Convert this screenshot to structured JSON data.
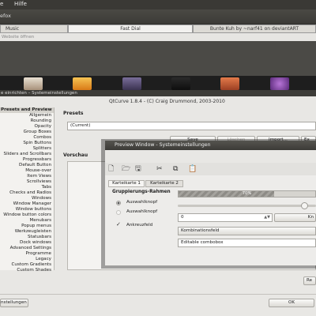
{
  "firefox": {
    "menu_left": "e",
    "menu_help": "Hilfe",
    "title": "efox",
    "tabs": [
      "Music",
      "Fast Dial",
      "Bunte Kuh by ~narf41 on deviantART"
    ],
    "url_placeholder": "Website öffnen"
  },
  "qtcurve": {
    "window_title": "e einrichten – Systemeinstellungen",
    "version": "QtCurve 1.8.4 - (C) Craig Drummond, 2003-2010",
    "categories": [
      "Presets and Preview",
      "Allgemein",
      "Rounding",
      "Opacity",
      "Group Boxes",
      "Combos",
      "Spin Buttons",
      "Splitters",
      "Sliders and Scrollbars",
      "Progressbars",
      "Default Button",
      "Mouse-over",
      "Item Views",
      "Scrollviews",
      "Tabs",
      "Checks and Radios",
      "Windows",
      "Window Manager",
      "Window buttons",
      "Window button colors",
      "Menubars",
      "Popup menus",
      "Werkzeugleisten",
      "Statusbars",
      "Dock windows",
      "Advanced Settings",
      "Programme",
      "Legacy",
      "Custom Gradients",
      "Custom Shades"
    ],
    "presets_label": "Presets",
    "preset_value": "(Current)",
    "buttons": {
      "save": "Save",
      "delete": "Löschen",
      "import": "Import...",
      "export": "Ex"
    },
    "preview_label": "Vorschau",
    "bottom": {
      "left_button": "nstellungen",
      "ok": "OK",
      "right_button": "Re"
    }
  },
  "preview_window": {
    "title": "Preview Window - Systemeinstellungen",
    "toolbar_icons": [
      "new-document-icon",
      "open-folder-icon",
      "save-icon",
      "cut-icon",
      "copy-icon",
      "paste-icon"
    ],
    "tabs": [
      "Karteikarte 1",
      "Karteikarte 2"
    ],
    "group_title": "Gruppierungs-Rahmen",
    "radio1": "Auswahlknopf",
    "radio2": "Auswahlknopf",
    "checkbox": "Ankreuzfeld",
    "progress_text": "70%",
    "progress_value": 0.7,
    "spin_value": "0",
    "combo_label": "Kombinationsfeld",
    "editable_combo": "Editable combobox",
    "right_btn": "Kn"
  },
  "colors": {
    "accent": "#d4d2cc",
    "window_bg": "#e8e7e4"
  }
}
